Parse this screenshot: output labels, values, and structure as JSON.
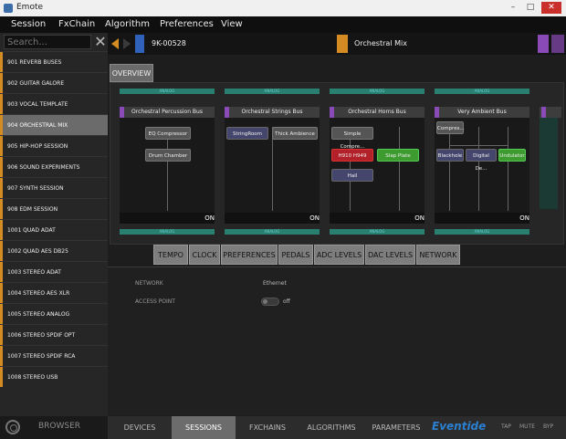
{
  "window": {
    "title": "Emote",
    "min": "–",
    "max": "□",
    "close": "✕"
  },
  "menu": [
    "Session",
    "FxChain",
    "Algorithm",
    "Preferences",
    "View"
  ],
  "sidebar": {
    "search_placeholder": "Search...",
    "items": [
      {
        "label": "901 REVERB BUSES",
        "selected": false
      },
      {
        "label": "902 GUITAR GALORE",
        "selected": false
      },
      {
        "label": "903 VOCAL TEMPLATE",
        "selected": false
      },
      {
        "label": "904 ORCHESTRAL MIX",
        "selected": true
      },
      {
        "label": "905 HIP-HOP SESSION",
        "selected": false
      },
      {
        "label": "906 SOUND EXPERIMENTS",
        "selected": false
      },
      {
        "label": "907 SYNTH SESSION",
        "selected": false
      },
      {
        "label": "908 EDM SESSION",
        "selected": false
      },
      {
        "label": "1001 QUAD ADAT",
        "selected": false
      },
      {
        "label": "1002 QUAD AES DB25",
        "selected": false
      },
      {
        "label": "1003 STEREO ADAT",
        "selected": false
      },
      {
        "label": "1004 STEREO AES XLR",
        "selected": false
      },
      {
        "label": "1005 STEREO ANALOG",
        "selected": false
      },
      {
        "label": "1006 STEREO SPDIF OPT",
        "selected": false
      },
      {
        "label": "1007 STEREO SPDIF RCA",
        "selected": false
      },
      {
        "label": "1008 STEREO USB",
        "selected": false
      }
    ],
    "browser_label": "BROWSER"
  },
  "preset": {
    "device": "9K-00528",
    "name": "Orchestral Mix"
  },
  "overview_tab": "OVERVIEW",
  "analog_label": "ANALOG",
  "on_label": "ON",
  "buses": [
    {
      "name": "Orchestral Percussion Bus",
      "fx": [
        "EQ Compressor",
        "Drum Chamber"
      ]
    },
    {
      "name": "Orchestral Strings Bus",
      "fx": [
        "StringRoom",
        "Thick Ambience"
      ]
    },
    {
      "name": "Orchestral Horns Bus",
      "fx": [
        "Simple Compre...",
        "H910 H949",
        "Slap Plate",
        "Hall"
      ]
    },
    {
      "name": "Very Ambient Bus",
      "fx": [
        "Compres...",
        "Blackhole",
        "Digital De...",
        "Undulator"
      ]
    }
  ],
  "subtabs": [
    "TEMPO",
    "CLOCK",
    "PREFERENCES",
    "PEDALS",
    "ADC LEVELS",
    "DAC LEVELS",
    "NETWORK"
  ],
  "settings": {
    "network_label": "NETWORK",
    "network_value": "Ethernet",
    "access_point_label": "ACCESS POINT",
    "access_point_value": "off"
  },
  "bottom_nav": [
    "DEVICES",
    "SESSIONS",
    "FXCHAINS",
    "ALGORITHMS",
    "PARAMETERS"
  ],
  "brand": "Eventide",
  "right_buttons": [
    "TAP",
    "MUTE",
    "BYP"
  ],
  "colors": {
    "accent_orange": "#d48c22",
    "bus_purple": "#8a4ab7",
    "analog_teal": "#2a8070",
    "brand_blue": "#2b7fd0"
  }
}
